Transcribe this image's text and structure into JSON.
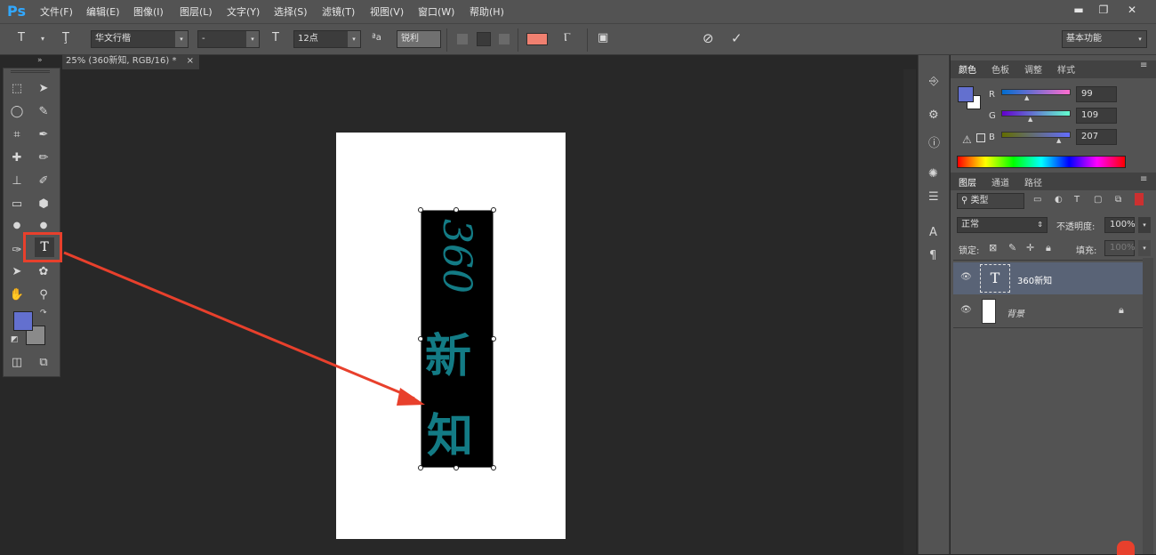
{
  "app": {
    "logo": "Ps"
  },
  "menu": [
    "文件(F)",
    "编辑(E)",
    "图像(I)",
    "图层(L)",
    "文字(Y)",
    "选择(S)",
    "滤镜(T)",
    "视图(V)",
    "窗口(W)",
    "帮助(H)"
  ],
  "window_controls": {
    "minimize": "▬",
    "restore": "❐",
    "close": "✕"
  },
  "options": {
    "tool_glyph": "T",
    "orient_glyph": "Ţ",
    "font_family": "华文行楷",
    "font_style": "-",
    "size_glyph": "T",
    "font_size": "12点",
    "aa_glyph": "ªa",
    "aa_mode": "锐利",
    "text_color": "#f08070",
    "workspace": "基本功能"
  },
  "doc_tab": {
    "title": "25% (360新知, RGB/16) *",
    "close": "×"
  },
  "tools": [
    [
      "⬚",
      "➤"
    ],
    [
      "◯",
      "✎"
    ],
    [
      "⌗",
      "✒"
    ],
    [
      "✚",
      "✏"
    ],
    [
      "⊥",
      "✐"
    ],
    [
      "▭",
      "⬢"
    ],
    [
      "●",
      "●"
    ],
    [
      "✑",
      "T"
    ],
    [
      "➤",
      "✿"
    ],
    [
      "✋",
      "⚲"
    ]
  ],
  "colors": {
    "foreground": "#6370cf",
    "background": "#8a8a8a",
    "panel_fg": "#6370cf"
  },
  "canvas": {
    "num_text": "360",
    "cjk_1": "新",
    "cjk_2": "知",
    "text_color": "#137b85"
  },
  "color_panel": {
    "tabs": [
      "颜色",
      "色板",
      "调整",
      "样式"
    ],
    "channels": [
      {
        "label": "R",
        "value": "99"
      },
      {
        "label": "G",
        "value": "109"
      },
      {
        "label": "B",
        "value": "207"
      }
    ]
  },
  "layers_panel": {
    "tabs": [
      "图层",
      "通道",
      "路径"
    ],
    "filter_label": "类型",
    "blend_mode": "正常",
    "opacity_label": "不透明度:",
    "opacity_value": "100%",
    "lock_label": "锁定:",
    "fill_label": "填充:",
    "fill_value": "100%",
    "layers": [
      {
        "name": "360新知",
        "type": "text",
        "selected": true
      },
      {
        "name": "背景",
        "type": "image",
        "locked": true
      }
    ]
  }
}
